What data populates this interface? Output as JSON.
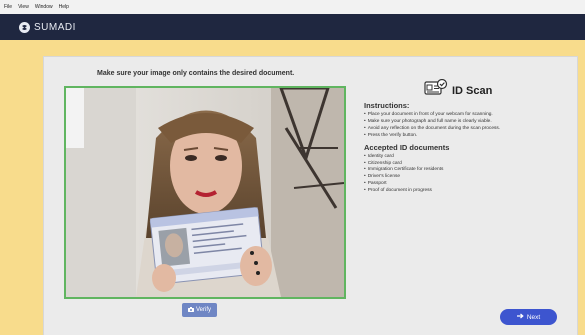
{
  "menu": [
    "File",
    "View",
    "Window",
    "Help"
  ],
  "app": {
    "name": "SUMADI"
  },
  "capture": {
    "instruction": "Make sure your image only contains the desired document.",
    "verify_label": "Verify"
  },
  "idscan": {
    "title": "ID Scan",
    "instructions_heading": "Instructions:",
    "instructions": [
      "Place your document in front of your webcam for scanning.",
      "Make sure your photograph and full name is clearly viable.",
      "Avoid any reflection on the document during the scan process.",
      "Press the Verify button."
    ],
    "accepted_heading": "Accepted ID documents",
    "accepted": [
      "Identity card",
      "Citizenship card",
      "Immigration Certificate for residents",
      "Driver's license",
      "Passport",
      "Proof of document in progress"
    ]
  },
  "footer": {
    "next_label": "Next"
  },
  "colors": {
    "frame": "#60b560",
    "primary": "#3d55cf",
    "header": "#1f2740"
  }
}
